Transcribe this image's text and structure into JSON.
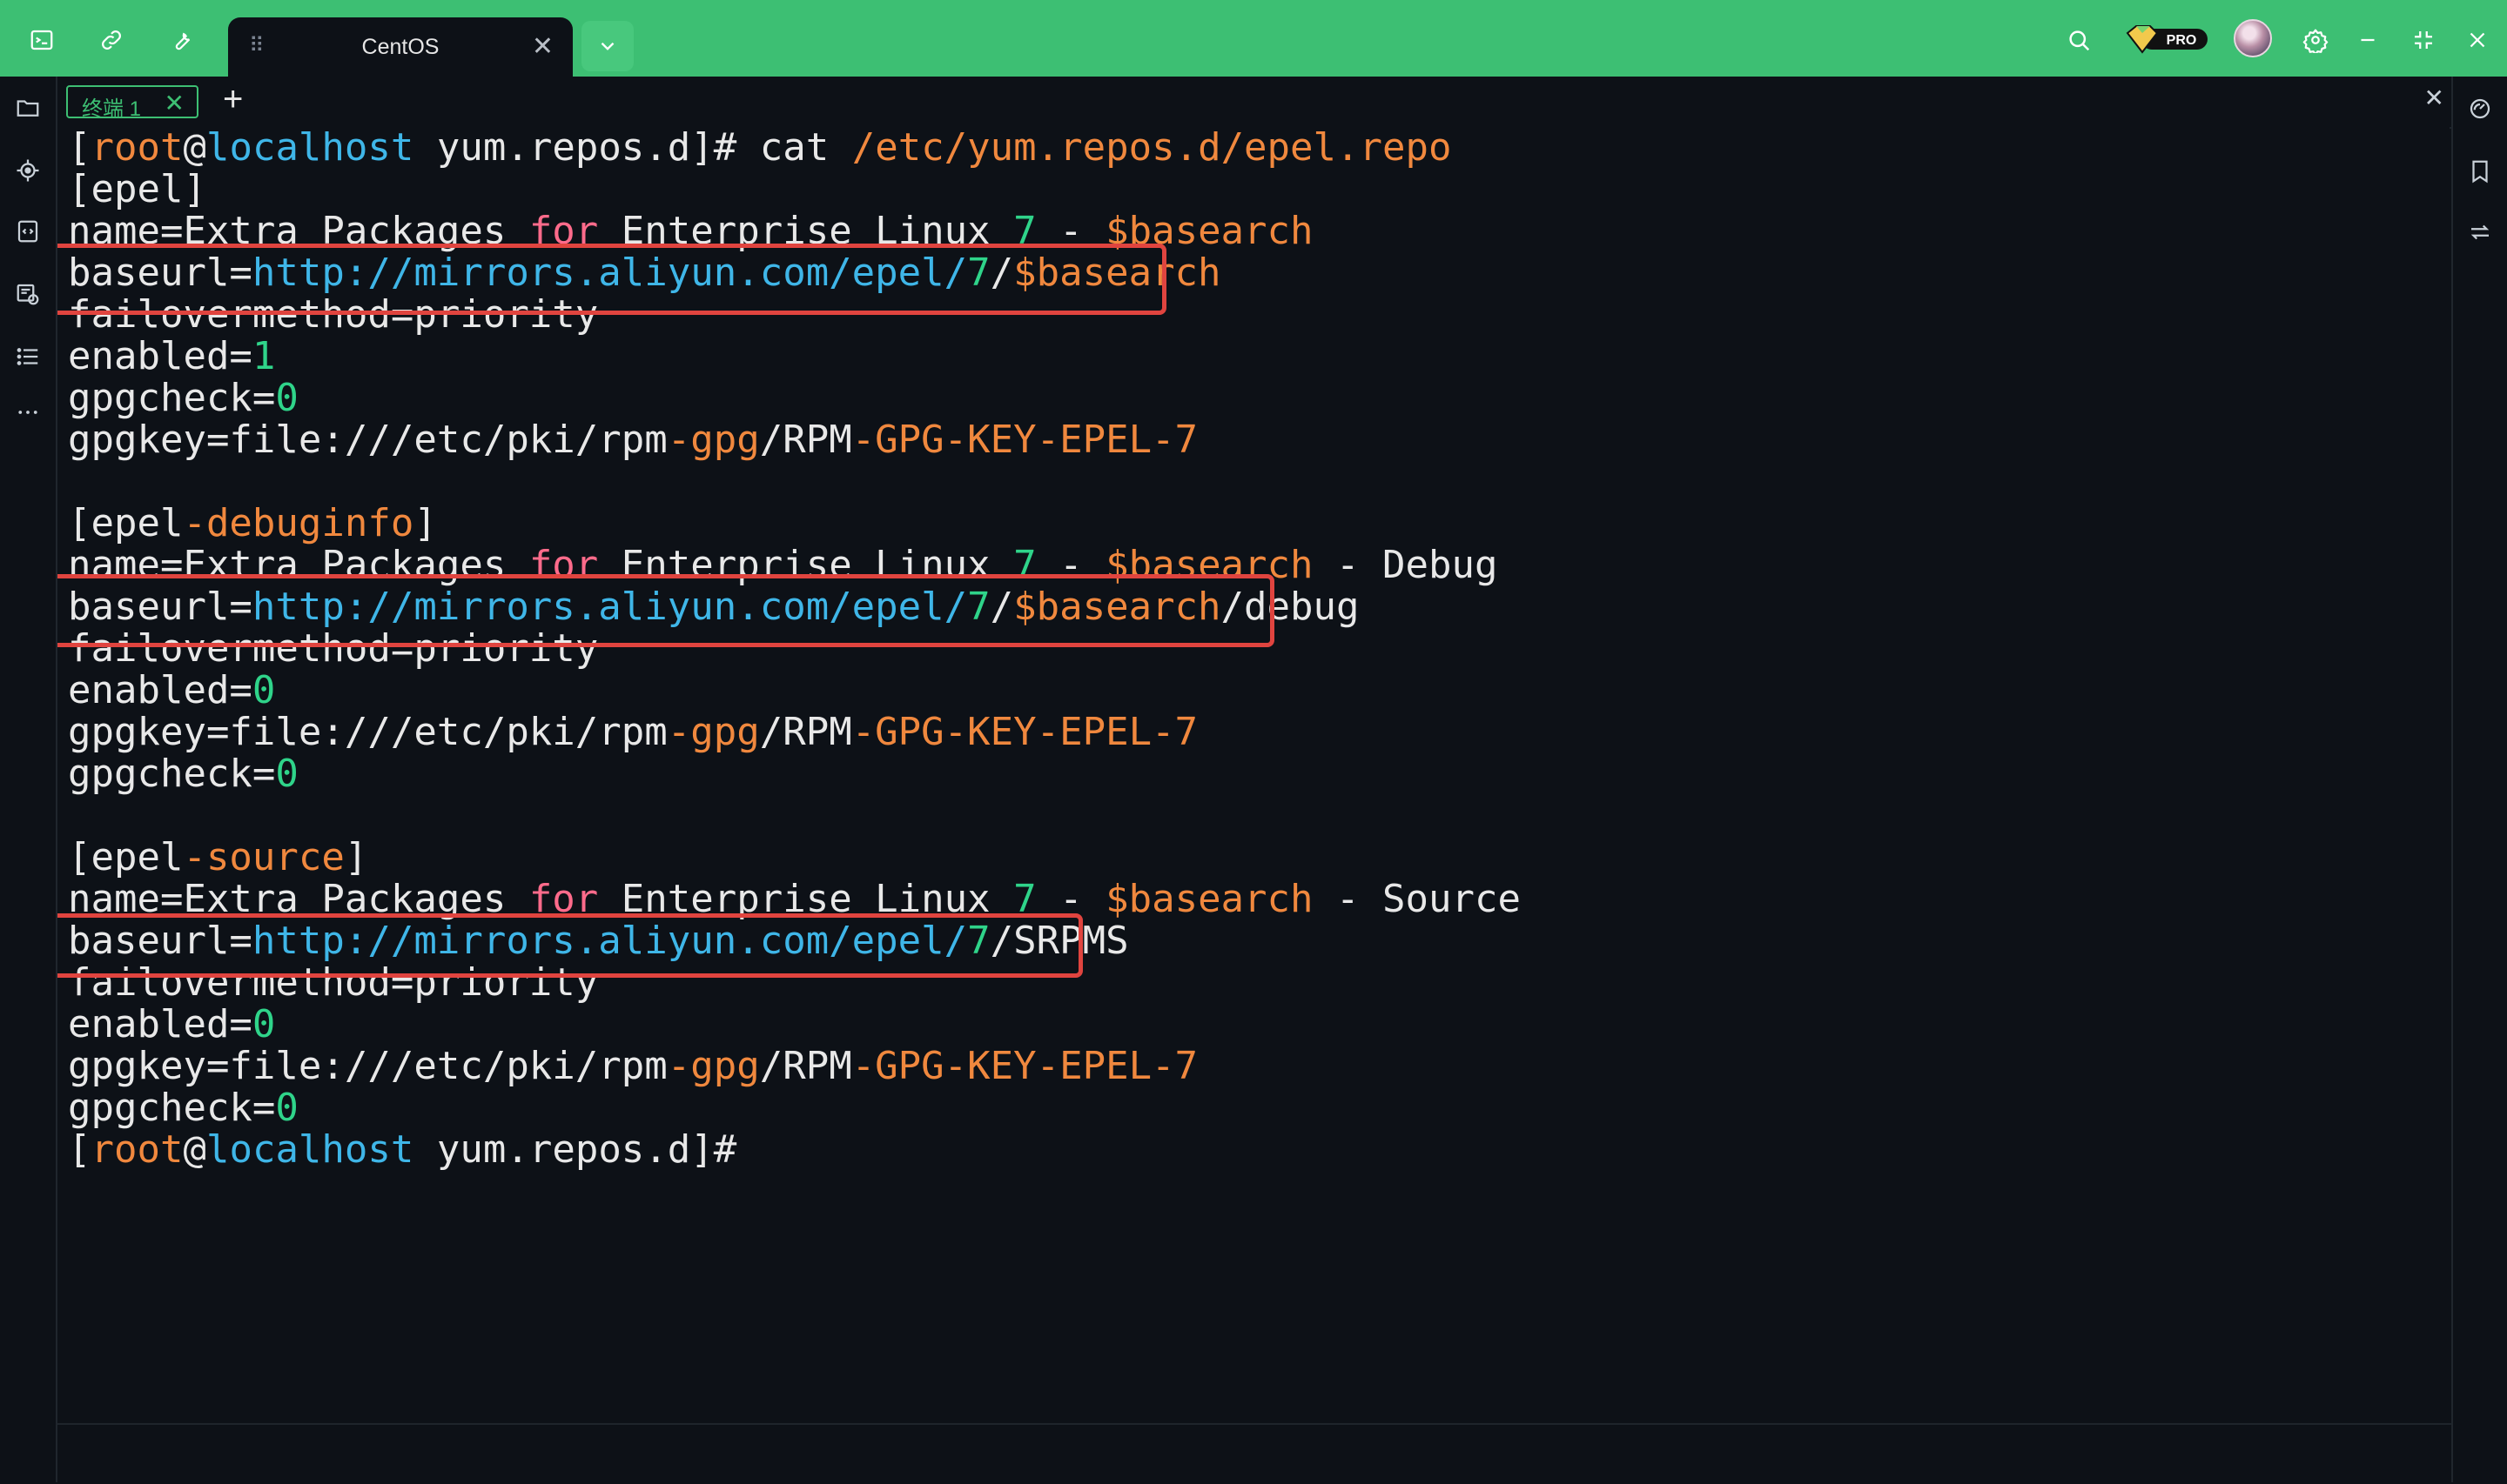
{
  "window": {
    "tab_title": "CentOS",
    "pro_label": "PRO",
    "accent_color": "#3dbf73",
    "toolbar_icons": [
      "terminal-icon",
      "link-icon",
      "wrench-icon"
    ],
    "right_icons": [
      "search-icon",
      "pro-badge-icon",
      "avatar",
      "settings-icon",
      "minimize-icon",
      "restore-icon",
      "close-icon"
    ]
  },
  "terminal_tabs": {
    "tab_label": "终端 1",
    "close_glyph": "✕",
    "add_glyph": "+"
  },
  "terminal": {
    "lines": [
      [
        {
          "t": "[",
          "c": "white"
        },
        {
          "t": "root",
          "c": "orange"
        },
        {
          "t": "@",
          "c": "white"
        },
        {
          "t": "localhost",
          "c": "cyan"
        },
        {
          "t": " yum.repos.d]# cat ",
          "c": "white"
        },
        {
          "t": "/etc/yum.repos.d/epel.repo",
          "c": "orange"
        }
      ],
      [
        {
          "t": "[epel]",
          "c": "white"
        }
      ],
      [
        {
          "t": "name=Extra Packages ",
          "c": "white"
        },
        {
          "t": "for",
          "c": "pink"
        },
        {
          "t": " Enterprise Linux ",
          "c": "white"
        },
        {
          "t": "7",
          "c": "green"
        },
        {
          "t": " - ",
          "c": "white"
        },
        {
          "t": "$basearch",
          "c": "orange"
        }
      ],
      [
        {
          "t": "baseurl=",
          "c": "white"
        },
        {
          "t": "http://mirrors.aliyun.com/epel/",
          "c": "cyan"
        },
        {
          "t": "7",
          "c": "green"
        },
        {
          "t": "/",
          "c": "white"
        },
        {
          "t": "$basearch",
          "c": "orange"
        }
      ],
      [
        {
          "t": "failovermethod=priority",
          "c": "white"
        }
      ],
      [
        {
          "t": "enabled=",
          "c": "white"
        },
        {
          "t": "1",
          "c": "green"
        }
      ],
      [
        {
          "t": "gpgcheck=",
          "c": "white"
        },
        {
          "t": "0",
          "c": "green"
        }
      ],
      [
        {
          "t": "gpgkey=file:///etc/pki/rpm",
          "c": "white"
        },
        {
          "t": "-gpg",
          "c": "orange"
        },
        {
          "t": "/RPM",
          "c": "white"
        },
        {
          "t": "-GPG-KEY-EPEL-7",
          "c": "orange"
        }
      ],
      [
        {
          "t": "",
          "c": "white"
        }
      ],
      [
        {
          "t": "[epel",
          "c": "white"
        },
        {
          "t": "-debuginfo",
          "c": "orange"
        },
        {
          "t": "]",
          "c": "white"
        }
      ],
      [
        {
          "t": "name=Extra Packages ",
          "c": "white"
        },
        {
          "t": "for",
          "c": "pink"
        },
        {
          "t": " Enterprise Linux ",
          "c": "white"
        },
        {
          "t": "7",
          "c": "green"
        },
        {
          "t": " - ",
          "c": "white"
        },
        {
          "t": "$basearch",
          "c": "orange"
        },
        {
          "t": " - Debug",
          "c": "white"
        }
      ],
      [
        {
          "t": "baseurl=",
          "c": "white"
        },
        {
          "t": "http://mirrors.aliyun.com/epel/",
          "c": "cyan"
        },
        {
          "t": "7",
          "c": "green"
        },
        {
          "t": "/",
          "c": "white"
        },
        {
          "t": "$basearch",
          "c": "orange"
        },
        {
          "t": "/debug",
          "c": "white"
        }
      ],
      [
        {
          "t": "failovermethod=priority",
          "c": "white"
        }
      ],
      [
        {
          "t": "enabled=",
          "c": "white"
        },
        {
          "t": "0",
          "c": "green"
        }
      ],
      [
        {
          "t": "gpgkey=file:///etc/pki/rpm",
          "c": "white"
        },
        {
          "t": "-gpg",
          "c": "orange"
        },
        {
          "t": "/RPM",
          "c": "white"
        },
        {
          "t": "-GPG-KEY-EPEL-7",
          "c": "orange"
        }
      ],
      [
        {
          "t": "gpgcheck=",
          "c": "white"
        },
        {
          "t": "0",
          "c": "green"
        }
      ],
      [
        {
          "t": "",
          "c": "white"
        }
      ],
      [
        {
          "t": "[epel",
          "c": "white"
        },
        {
          "t": "-source",
          "c": "orange"
        },
        {
          "t": "]",
          "c": "white"
        }
      ],
      [
        {
          "t": "name=Extra Packages ",
          "c": "white"
        },
        {
          "t": "for",
          "c": "pink"
        },
        {
          "t": " Enterprise Linux ",
          "c": "white"
        },
        {
          "t": "7",
          "c": "green"
        },
        {
          "t": " - ",
          "c": "white"
        },
        {
          "t": "$basearch",
          "c": "orange"
        },
        {
          "t": " - Source",
          "c": "white"
        }
      ],
      [
        {
          "t": "baseurl=",
          "c": "white"
        },
        {
          "t": "http://mirrors.aliyun.com/epel/",
          "c": "cyan"
        },
        {
          "t": "7",
          "c": "green"
        },
        {
          "t": "/SRPMS",
          "c": "white"
        }
      ],
      [
        {
          "t": "failovermethod=priority",
          "c": "white"
        }
      ],
      [
        {
          "t": "enabled=",
          "c": "white"
        },
        {
          "t": "0",
          "c": "green"
        }
      ],
      [
        {
          "t": "gpgkey=file:///etc/pki/rpm",
          "c": "white"
        },
        {
          "t": "-gpg",
          "c": "orange"
        },
        {
          "t": "/RPM",
          "c": "white"
        },
        {
          "t": "-GPG-KEY-EPEL-7",
          "c": "orange"
        }
      ],
      [
        {
          "t": "gpgcheck=",
          "c": "white"
        },
        {
          "t": "0",
          "c": "green"
        }
      ],
      [
        {
          "t": "[",
          "c": "white"
        },
        {
          "t": "root",
          "c": "orange"
        },
        {
          "t": "@",
          "c": "white"
        },
        {
          "t": "localhost",
          "c": "cyan"
        },
        {
          "t": " yum.repos.d]#",
          "c": "white"
        }
      ]
    ],
    "highlight_color": "#e0443f"
  }
}
